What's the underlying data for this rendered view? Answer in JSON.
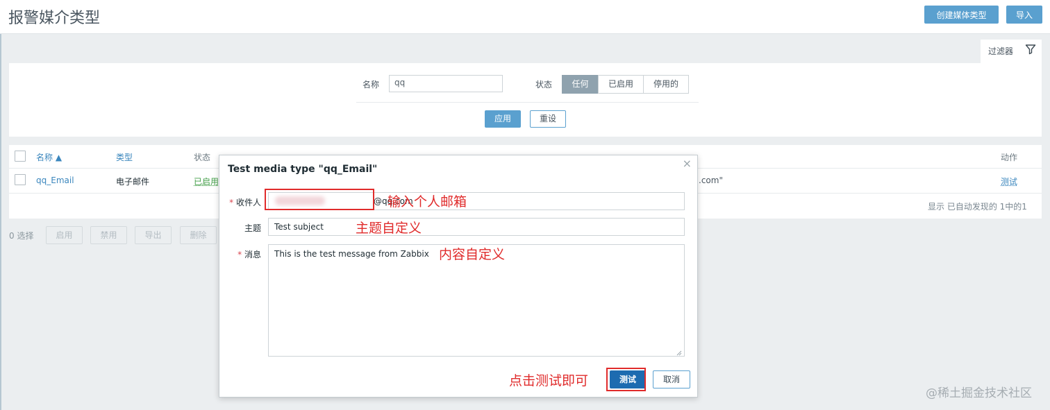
{
  "header": {
    "title": "报警媒介类型",
    "create_label": "创建媒体类型",
    "import_label": "导入"
  },
  "filter": {
    "tab_label": "过滤器",
    "name_label": "名称",
    "name_value": "qq",
    "status_label": "状态",
    "status_options": [
      "任何",
      "已启用",
      "停用的"
    ],
    "apply_label": "应用",
    "reset_label": "重设"
  },
  "table": {
    "headers": {
      "name": "名称 ▲",
      "type": "类型",
      "status": "状态",
      "action": "动作"
    },
    "row": {
      "name": "qq_Email",
      "type": "电子邮件",
      "status": "已启用",
      "details_tail": ".com\"",
      "action": "测试"
    },
    "footer": "显示 已自动发现的 1中的1"
  },
  "actions": {
    "selected": "0 选择",
    "buttons": [
      "启用",
      "禁用",
      "导出",
      "删除"
    ]
  },
  "modal": {
    "title": "Test media type \"qq_Email\"",
    "close": "×",
    "recipient_label": "收件人",
    "recipient_value": "@qq.com",
    "subject_label": "主题",
    "subject_value": "Test subject",
    "message_label": "消息",
    "message_value": "This is the test message from Zabbix",
    "required_mark": "*",
    "test_label": "测试",
    "cancel_label": "取消"
  },
  "annotations": {
    "recipient_note": "输入个人邮箱",
    "subject_note": "主题自定义",
    "message_note": "内容自定义",
    "test_note": "点击测试即可"
  },
  "watermark": "@稀土掘金技术社区",
  "colors": {
    "accent": "#5aa0cf",
    "annotation_red": "#e02b2b",
    "enabled_green": "#429e47"
  }
}
